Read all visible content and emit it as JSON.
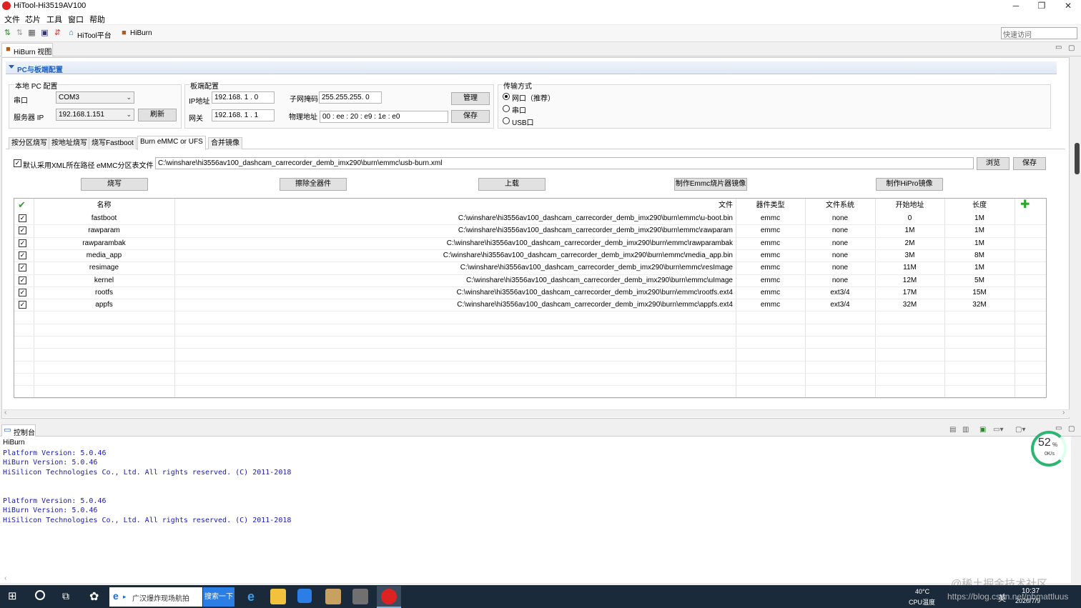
{
  "window": {
    "title": "HiTool-Hi3519AV100",
    "minimize": "─",
    "maximize": "❐",
    "close": "✕"
  },
  "menu": [
    "文件",
    "芯片",
    "工具",
    "窗口",
    "帮助"
  ],
  "toolbar": {
    "hitool_platform": "HiTool平台",
    "hiburn": "HiBurn",
    "quick_access_placeholder": "快速访问"
  },
  "view_tab": {
    "label": "HiBurn 视图"
  },
  "section": {
    "title": "PC与板端配置"
  },
  "local_pc": {
    "title": "本地 PC 配置",
    "serial_label": "串口",
    "serial_value": "COM3",
    "server_ip_label": "服务器 IP",
    "server_ip_value": "192.168.1.151",
    "refresh_label": "刷新"
  },
  "board": {
    "title": "板端配置",
    "ip_label": "IP地址",
    "ip_value": "192.168. 1 . 0",
    "mask_label": "子网掩码",
    "mask_value": "255.255.255. 0",
    "gateway_label": "网关",
    "gateway_value": "192.168. 1 . 1",
    "mac_label": "物理地址",
    "mac_value": "00 : ee : 20 : e9 : 1e : e0",
    "manage_label": "管理",
    "save_label": "保存"
  },
  "transfer": {
    "title": "传输方式",
    "options": [
      {
        "label": "网口（推荐）",
        "selected": true
      },
      {
        "label": "串口",
        "selected": false
      },
      {
        "label": "USB口",
        "selected": false
      }
    ]
  },
  "tabs": [
    "按分区烧写",
    "按地址烧写",
    "烧写Fastboot",
    "Burn eMMC or UFS",
    "合并镜像"
  ],
  "active_tab": "Burn eMMC or UFS",
  "xml": {
    "default_checkbox_label": "默认采用XML所在路径",
    "partition_label": "eMMC分区表文件",
    "path": "C:\\winshare\\hi3556av100_dashcam_carrecorder_demb_imx290\\burn\\emmc\\usb-burn.xml",
    "browse_label": "浏览",
    "save_label": "保存"
  },
  "actions": [
    "烧写",
    "擦除全器件",
    "上载",
    "制作Emmc烧片器镜像",
    "制作HiPro镜像"
  ],
  "table": {
    "headers": [
      "名称",
      "文件",
      "器件类型",
      "文件系统",
      "开始地址",
      "长度"
    ],
    "rows": [
      {
        "name": "fastboot",
        "file": "C:\\winshare\\hi3556av100_dashcam_carrecorder_demb_imx290\\burn\\emmc\\u-boot.bin",
        "type": "emmc",
        "fs": "none",
        "start": "0",
        "length": "1M"
      },
      {
        "name": "rawparam",
        "file": "C:\\winshare\\hi3556av100_dashcam_carrecorder_demb_imx290\\burn\\emmc\\rawparam",
        "type": "emmc",
        "fs": "none",
        "start": "1M",
        "length": "1M"
      },
      {
        "name": "rawparambak",
        "file": "C:\\winshare\\hi3556av100_dashcam_carrecorder_demb_imx290\\burn\\emmc\\rawparambak",
        "type": "emmc",
        "fs": "none",
        "start": "2M",
        "length": "1M"
      },
      {
        "name": "media_app",
        "file": "C:\\winshare\\hi3556av100_dashcam_carrecorder_demb_imx290\\burn\\emmc\\media_app.bin",
        "type": "emmc",
        "fs": "none",
        "start": "3M",
        "length": "8M"
      },
      {
        "name": "resimage",
        "file": "C:\\winshare\\hi3556av100_dashcam_carrecorder_demb_imx290\\burn\\emmc\\resImage",
        "type": "emmc",
        "fs": "none",
        "start": "11M",
        "length": "1M"
      },
      {
        "name": "kernel",
        "file": "C:\\winshare\\hi3556av100_dashcam_carrecorder_demb_imx290\\burn\\emmc\\uImage",
        "type": "emmc",
        "fs": "none",
        "start": "12M",
        "length": "5M"
      },
      {
        "name": "rootfs",
        "file": "C:\\winshare\\hi3556av100_dashcam_carrecorder_demb_imx290\\burn\\emmc\\rootfs.ext4",
        "type": "emmc",
        "fs": "ext3/4",
        "start": "17M",
        "length": "15M"
      },
      {
        "name": "appfs",
        "file": "C:\\winshare\\hi3556av100_dashcam_carrecorder_demb_imx290\\burn\\emmc\\appfs.ext4",
        "type": "emmc",
        "fs": "ext3/4",
        "start": "32M",
        "length": "32M"
      }
    ]
  },
  "console": {
    "tab_label": "控制台",
    "name": "HiBurn",
    "lines": [
      "Platform Version: 5.0.46",
      "HiBurn Version: 5.0.46",
      "HiSilicon Technologies Co., Ltd. All rights reserved. (C) 2011-2018",
      "",
      "",
      "Platform Version: 5.0.46",
      "HiBurn Version: 5.0.46",
      "HiSilicon Technologies Co., Ltd. All rights reserved. (C) 2011-2018"
    ]
  },
  "net_widget": {
    "percent": "52",
    "percent_unit": "%",
    "speed": "0K/s"
  },
  "taskbar": {
    "search_text": "广汉爆炸现场航拍",
    "search_button": "搜索一下",
    "temp": "40°C",
    "cpu_label": "CPU温度",
    "time": "10:37",
    "date": "2020/7/9",
    "ime": "英"
  },
  "watermark": {
    "line1": "@稀土掘金技术社区",
    "line2": "https://blog.csdn.net/pbmattluus"
  },
  "colors": {
    "accent": "#1f5fbf",
    "console_text": "#1a1ab5",
    "taskbar": "#1b2a3a",
    "ring": "#2bb673"
  }
}
